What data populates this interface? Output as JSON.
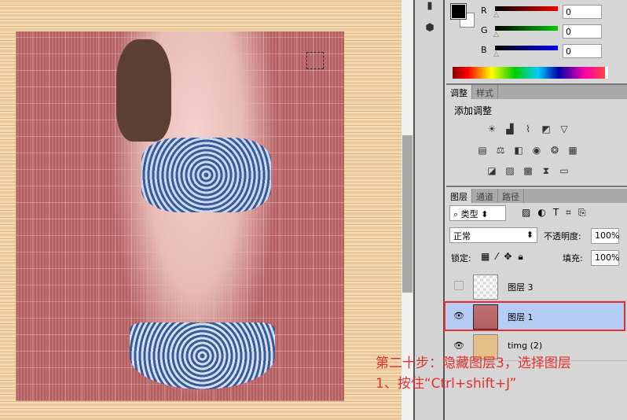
{
  "canvas": {
    "selection": "marquee"
  },
  "color_panel": {
    "channels": [
      {
        "label": "R",
        "value": "0",
        "color": "#e00000"
      },
      {
        "label": "G",
        "value": "0",
        "color": "#00c000"
      },
      {
        "label": "B",
        "value": "0",
        "color": "#0000e0"
      }
    ]
  },
  "adjust_panel": {
    "tabs": [
      "调整",
      "样式"
    ],
    "title": "添加调整"
  },
  "layers_panel": {
    "tabs": [
      "图层",
      "通道",
      "路径"
    ],
    "filter": "类型",
    "blend_mode": "正常",
    "opacity_label": "不透明度:",
    "opacity": "100%",
    "lock_label": "锁定:",
    "fill_label": "填充:",
    "fill": "100%",
    "layers": [
      {
        "name": "图层 3",
        "visible": false
      },
      {
        "name": "图层 1",
        "visible": true,
        "selected": true
      },
      {
        "name": "timg (2)",
        "visible": true
      }
    ]
  },
  "annotation": {
    "line1": "第二十步：隐藏图层3，选择图层",
    "line2": "1、按住“Ctrl+shift+J”"
  }
}
